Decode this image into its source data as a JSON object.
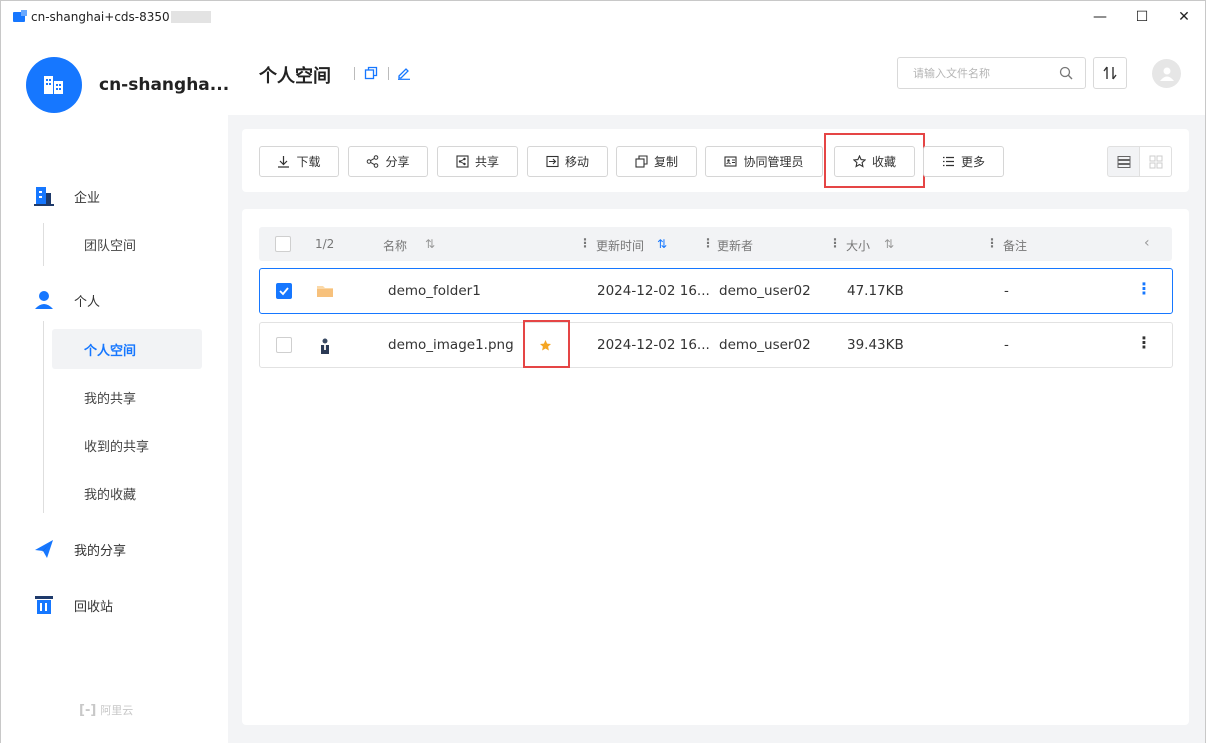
{
  "window": {
    "title": "cn-shanghai+cds-8350",
    "controls": {
      "minimize": "—",
      "maximize": "☐",
      "close": "✕"
    }
  },
  "sidebar": {
    "org_name": "cn-shangha...",
    "groups": [
      {
        "label": "企业",
        "icon": "enterprise-icon",
        "items": [
          "团队空间"
        ]
      },
      {
        "label": "个人",
        "icon": "person-icon",
        "items": [
          "个人空间",
          "我的共享",
          "收到的共享",
          "我的收藏"
        ]
      },
      {
        "label": "我的分享",
        "icon": "share-plane-icon",
        "items": []
      },
      {
        "label": "回收站",
        "icon": "trash-icon",
        "items": []
      }
    ],
    "active_item": "个人空间",
    "footer_logo": "阿里云"
  },
  "header": {
    "title": "个人空间",
    "search_placeholder": "请输入文件名称"
  },
  "toolbar": {
    "buttons": [
      {
        "label": "下载",
        "icon": "download-icon"
      },
      {
        "label": "分享",
        "icon": "share-icon"
      },
      {
        "label": "共享",
        "icon": "shared-icon"
      },
      {
        "label": "移动",
        "icon": "move-icon"
      },
      {
        "label": "复制",
        "icon": "copy-icon"
      },
      {
        "label": "协同管理员",
        "icon": "collaborator-icon"
      },
      {
        "label": "收藏",
        "icon": "star-outline-icon",
        "highlighted": true
      },
      {
        "label": "更多",
        "icon": "list-icon"
      }
    ]
  },
  "table": {
    "selection_count": "1/2",
    "columns": [
      "名称",
      "更新时间",
      "更新者",
      "大小",
      "备注"
    ],
    "rows": [
      {
        "name": "demo_folder1",
        "type": "folder",
        "selected": true,
        "starred": false,
        "updated": "2024-12-02 16...",
        "updater": "demo_user02",
        "size": "47.17KB",
        "note": "-"
      },
      {
        "name": "demo_image1.png",
        "type": "image",
        "selected": false,
        "starred": true,
        "updated": "2024-12-02 16...",
        "updater": "demo_user02",
        "size": "39.43KB",
        "note": "-"
      }
    ]
  },
  "colors": {
    "accent": "#1677ff",
    "highlight": "#e54545",
    "star": "#f5a623"
  }
}
